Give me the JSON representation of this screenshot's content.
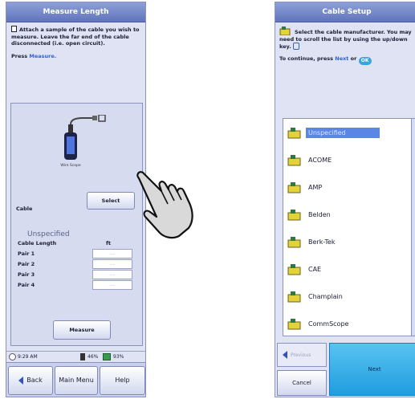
{
  "left": {
    "title": "Measure Length",
    "instruction": "Attach a sample of the cable you wish to measure. Leave the far end of the cable disconnected (i.e. open circuit).",
    "press_prefix": "Press",
    "press_link": "Measure.",
    "scope_caption": "Wire Scope",
    "cable_label": "Cable",
    "select_button": "Select",
    "cable_value": "Unspecified",
    "length_label": "Cable Length",
    "length_unit": "ft",
    "pairs": [
      {
        "label": "Pair 1",
        "value": "---"
      },
      {
        "label": "Pair 2",
        "value": "---"
      },
      {
        "label": "Pair 3",
        "value": "---"
      },
      {
        "label": "Pair 4",
        "value": "---"
      }
    ],
    "measure_button": "Measure",
    "status": {
      "time": "9:29 AM",
      "battery1": "46%",
      "battery2": "93%"
    },
    "nav": {
      "back": "Back",
      "main_menu": "Main Menu",
      "help": "Help"
    }
  },
  "right": {
    "title": "Cable Setup",
    "instruction": "Select the cable manufacturer. You may need to scroll the list by using the up/down key.",
    "press_prefix": "To continue, press",
    "press_link": "Next",
    "press_or": "or",
    "ok_label": "OK",
    "list": [
      {
        "label": "Unspecified",
        "selected": true
      },
      {
        "label": "ACOME",
        "selected": false
      },
      {
        "label": "AMP",
        "selected": false
      },
      {
        "label": "Belden",
        "selected": false
      },
      {
        "label": "Berk-Tek",
        "selected": false
      },
      {
        "label": "CAE",
        "selected": false
      },
      {
        "label": "Champlain",
        "selected": false
      },
      {
        "label": "CommScope",
        "selected": false
      }
    ],
    "nav": {
      "previous": "Previous",
      "cancel": "Cancel",
      "next": "Next"
    }
  },
  "colors": {
    "title_bar": "#6f83c8",
    "screen_bg": "#dfe3f4",
    "selection": "#5b86e6",
    "next_button": "#2aa6e4",
    "link": "#2f62d4"
  },
  "icons": [
    "document-icon",
    "wirescope-device-icon",
    "clock-icon",
    "battery-icon",
    "folder-bag-icon",
    "scroll-arrow-icon",
    "ok-icon",
    "pointing-hand-icon"
  ]
}
